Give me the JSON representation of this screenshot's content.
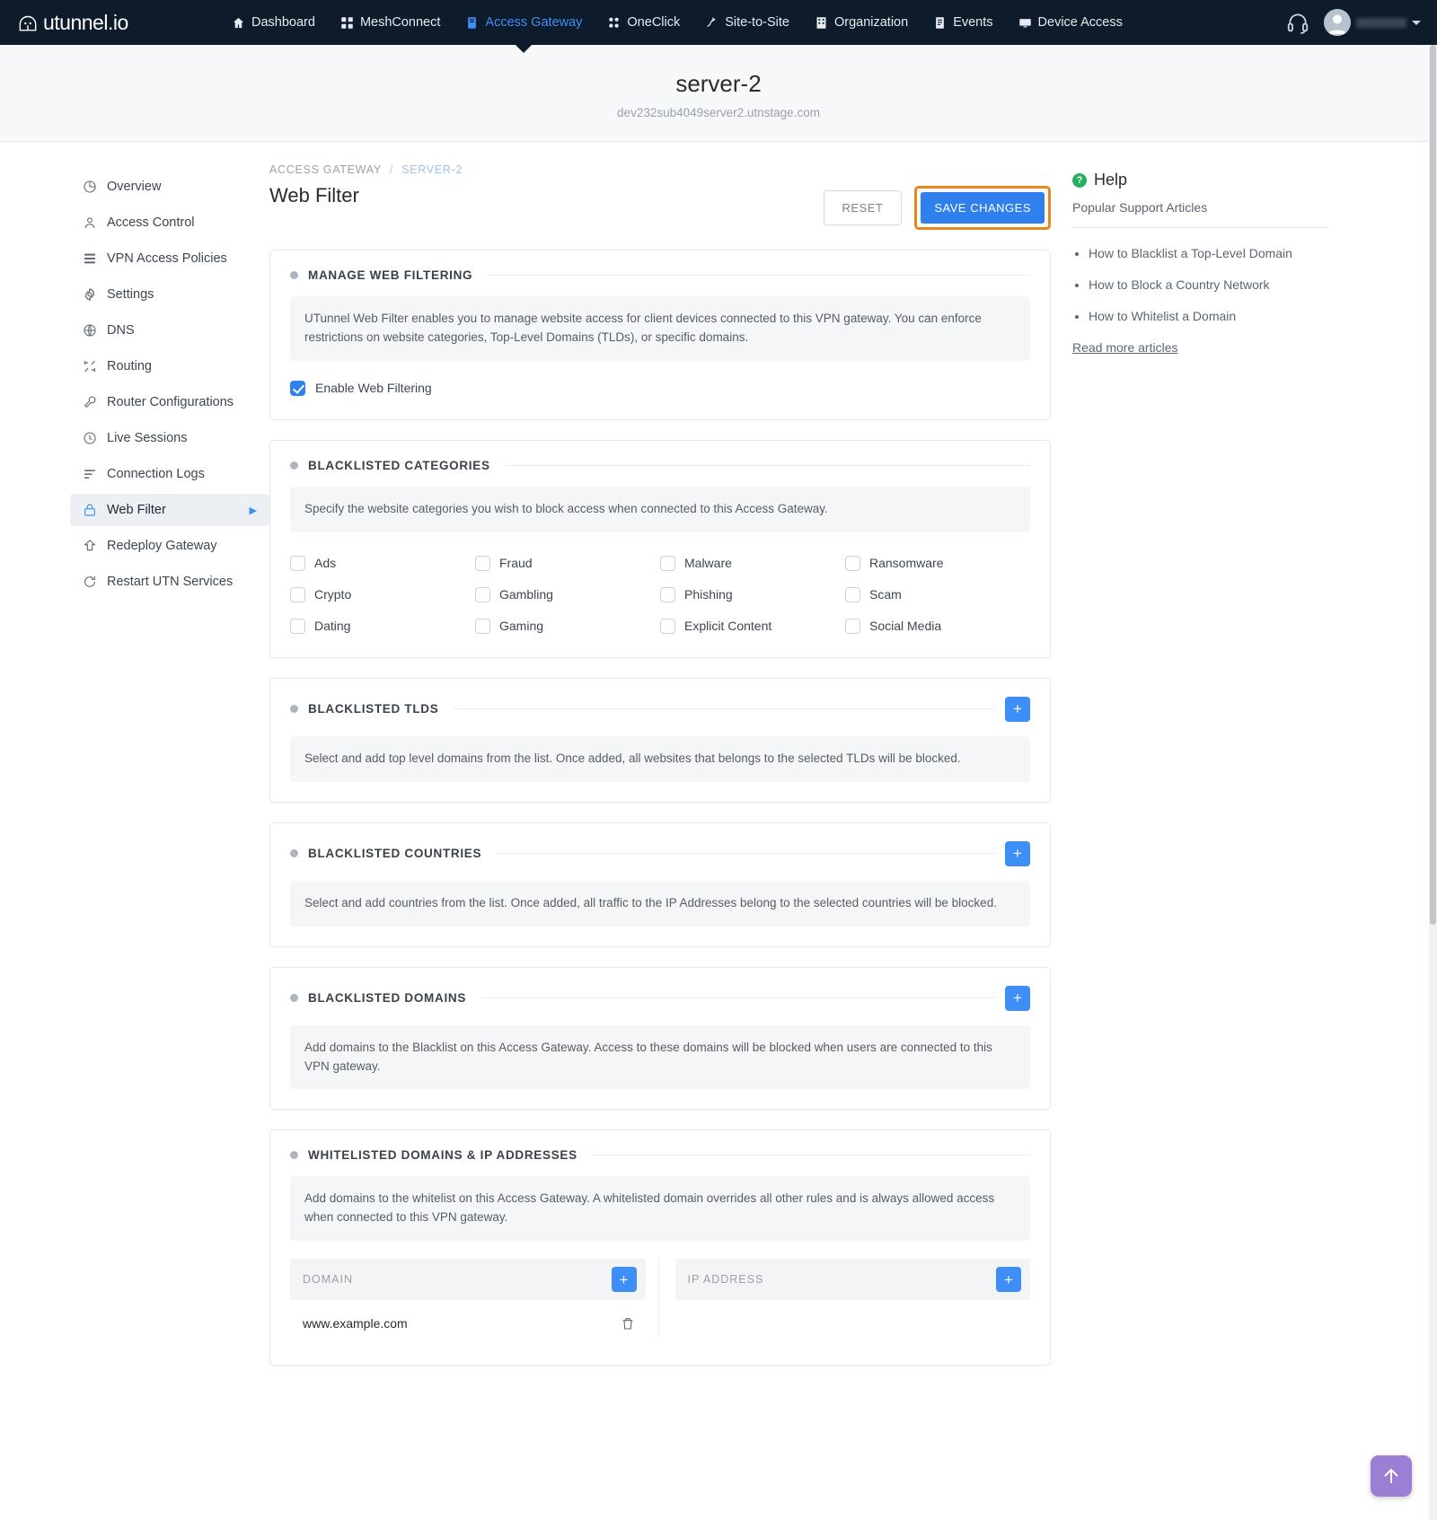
{
  "nav": {
    "brand": "utunnel.io",
    "items": [
      {
        "label": "Dashboard",
        "icon": "home-icon",
        "active": false
      },
      {
        "label": "MeshConnect",
        "icon": "mesh-icon",
        "active": false
      },
      {
        "label": "Access Gateway",
        "icon": "gateway-icon",
        "active": true
      },
      {
        "label": "OneClick",
        "icon": "oneclick-icon",
        "active": false
      },
      {
        "label": "Site-to-Site",
        "icon": "site-to-site-icon",
        "active": false
      },
      {
        "label": "Organization",
        "icon": "organization-icon",
        "active": false
      },
      {
        "label": "Events",
        "icon": "events-icon",
        "active": false
      },
      {
        "label": "Device Access",
        "icon": "monitor-icon",
        "active": false
      }
    ]
  },
  "header": {
    "title": "server-2",
    "subtitle": "dev232sub4049server2.utnstage.com"
  },
  "sidebar": {
    "items": [
      {
        "label": "Overview",
        "icon": "pie-chart-icon",
        "active": false
      },
      {
        "label": "Access Control",
        "icon": "person-icon",
        "active": false
      },
      {
        "label": "VPN Access Policies",
        "icon": "list-icon",
        "active": false
      },
      {
        "label": "Settings",
        "icon": "gear-icon",
        "active": false
      },
      {
        "label": "DNS",
        "icon": "globe-icon",
        "active": false
      },
      {
        "label": "Routing",
        "icon": "routing-icon",
        "active": false
      },
      {
        "label": "Router Configurations",
        "icon": "wrench-icon",
        "active": false
      },
      {
        "label": "Live Sessions",
        "icon": "clock-icon",
        "active": false
      },
      {
        "label": "Connection Logs",
        "icon": "logs-icon",
        "active": false
      },
      {
        "label": "Web Filter",
        "icon": "lock-icon",
        "active": true
      },
      {
        "label": "Redeploy Gateway",
        "icon": "upload-home-icon",
        "active": false
      },
      {
        "label": "Restart UTN Services",
        "icon": "restart-icon",
        "active": false
      }
    ]
  },
  "main": {
    "breadcrumb": {
      "root": "ACCESS GATEWAY",
      "separator": "/",
      "current": "SERVER-2"
    },
    "page_title": "Web Filter",
    "reset_label": "RESET",
    "save_label": "SAVE CHANGES",
    "sections": {
      "manage": {
        "title": "MANAGE WEB FILTERING",
        "note": "UTunnel Web Filter enables you to manage website access for client devices connected to this VPN gateway. You can enforce restrictions on website categories, Top-Level Domains (TLDs), or specific domains.",
        "enable_label": "Enable Web Filtering",
        "enable_checked": true
      },
      "categories": {
        "title": "BLACKLISTED CATEGORIES",
        "note": "Specify the website categories you wish to block access when connected to this Access Gateway.",
        "items": [
          {
            "label": "Ads",
            "checked": false
          },
          {
            "label": "Fraud",
            "checked": false
          },
          {
            "label": "Malware",
            "checked": false
          },
          {
            "label": "Ransomware",
            "checked": false
          },
          {
            "label": "Crypto",
            "checked": false
          },
          {
            "label": "Gambling",
            "checked": false
          },
          {
            "label": "Phishing",
            "checked": false
          },
          {
            "label": "Scam",
            "checked": false
          },
          {
            "label": "Dating",
            "checked": false
          },
          {
            "label": "Gaming",
            "checked": false
          },
          {
            "label": "Explicit Content",
            "checked": false
          },
          {
            "label": "Social Media",
            "checked": false
          }
        ]
      },
      "tlds": {
        "title": "BLACKLISTED TLDS",
        "note": "Select and add top level domains from the list. Once added, all websites that belongs to the selected TLDs will be blocked.",
        "add_label": "+"
      },
      "countries": {
        "title": "BLACKLISTED COUNTRIES",
        "note": "Select and add countries from the list. Once added, all traffic to the IP Addresses belong to the selected countries will be blocked.",
        "add_label": "+"
      },
      "domains": {
        "title": "BLACKLISTED DOMAINS",
        "note": "Add domains to the Blacklist on this Access Gateway. Access to these domains will be blocked when users are connected to this VPN gateway.",
        "add_label": "+"
      },
      "whitelist": {
        "title": "WHITELISTED DOMAINS & IP ADDRESSES",
        "note": "Add domains to the whitelist on this Access Gateway. A whitelisted domain overrides all other rules and is always allowed access when connected to this VPN gateway.",
        "domain_header": "DOMAIN",
        "ip_header": "IP ADDRESS",
        "add_label": "+",
        "domain_rows": [
          {
            "value": "www.example.com"
          }
        ],
        "ip_rows": []
      }
    }
  },
  "help": {
    "title": "Help",
    "subtitle": "Popular Support Articles",
    "articles": [
      "How to Blacklist a Top-Level Domain",
      "How to Block a Country Network",
      "How to Whitelist a Domain"
    ],
    "read_more": "Read more articles"
  },
  "fab": {
    "icon": "arrow-up-icon",
    "color": "#9b7fd4"
  }
}
